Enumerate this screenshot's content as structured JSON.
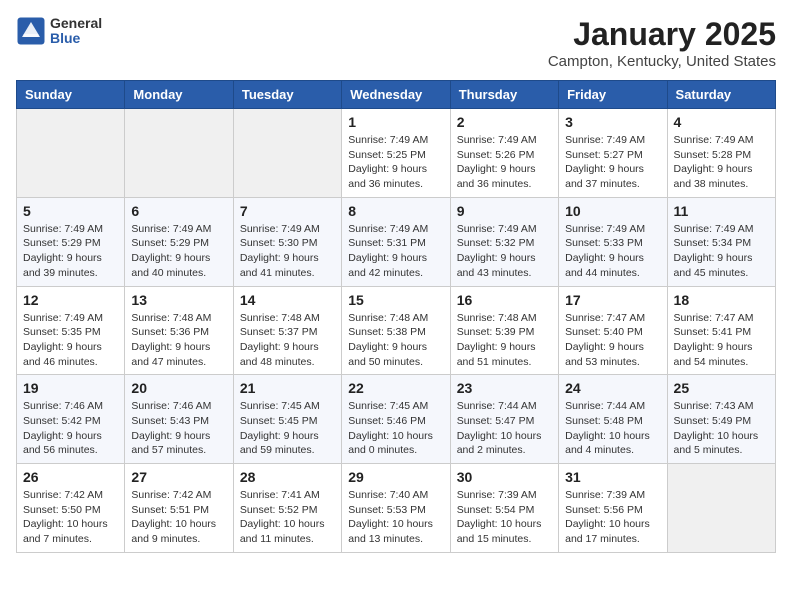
{
  "header": {
    "logo_general": "General",
    "logo_blue": "Blue",
    "month": "January 2025",
    "location": "Campton, Kentucky, United States"
  },
  "weekdays": [
    "Sunday",
    "Monday",
    "Tuesday",
    "Wednesday",
    "Thursday",
    "Friday",
    "Saturday"
  ],
  "weeks": [
    [
      {
        "day": "",
        "info": ""
      },
      {
        "day": "",
        "info": ""
      },
      {
        "day": "",
        "info": ""
      },
      {
        "day": "1",
        "info": "Sunrise: 7:49 AM\nSunset: 5:25 PM\nDaylight: 9 hours and 36 minutes."
      },
      {
        "day": "2",
        "info": "Sunrise: 7:49 AM\nSunset: 5:26 PM\nDaylight: 9 hours and 36 minutes."
      },
      {
        "day": "3",
        "info": "Sunrise: 7:49 AM\nSunset: 5:27 PM\nDaylight: 9 hours and 37 minutes."
      },
      {
        "day": "4",
        "info": "Sunrise: 7:49 AM\nSunset: 5:28 PM\nDaylight: 9 hours and 38 minutes."
      }
    ],
    [
      {
        "day": "5",
        "info": "Sunrise: 7:49 AM\nSunset: 5:29 PM\nDaylight: 9 hours and 39 minutes."
      },
      {
        "day": "6",
        "info": "Sunrise: 7:49 AM\nSunset: 5:29 PM\nDaylight: 9 hours and 40 minutes."
      },
      {
        "day": "7",
        "info": "Sunrise: 7:49 AM\nSunset: 5:30 PM\nDaylight: 9 hours and 41 minutes."
      },
      {
        "day": "8",
        "info": "Sunrise: 7:49 AM\nSunset: 5:31 PM\nDaylight: 9 hours and 42 minutes."
      },
      {
        "day": "9",
        "info": "Sunrise: 7:49 AM\nSunset: 5:32 PM\nDaylight: 9 hours and 43 minutes."
      },
      {
        "day": "10",
        "info": "Sunrise: 7:49 AM\nSunset: 5:33 PM\nDaylight: 9 hours and 44 minutes."
      },
      {
        "day": "11",
        "info": "Sunrise: 7:49 AM\nSunset: 5:34 PM\nDaylight: 9 hours and 45 minutes."
      }
    ],
    [
      {
        "day": "12",
        "info": "Sunrise: 7:49 AM\nSunset: 5:35 PM\nDaylight: 9 hours and 46 minutes."
      },
      {
        "day": "13",
        "info": "Sunrise: 7:48 AM\nSunset: 5:36 PM\nDaylight: 9 hours and 47 minutes."
      },
      {
        "day": "14",
        "info": "Sunrise: 7:48 AM\nSunset: 5:37 PM\nDaylight: 9 hours and 48 minutes."
      },
      {
        "day": "15",
        "info": "Sunrise: 7:48 AM\nSunset: 5:38 PM\nDaylight: 9 hours and 50 minutes."
      },
      {
        "day": "16",
        "info": "Sunrise: 7:48 AM\nSunset: 5:39 PM\nDaylight: 9 hours and 51 minutes."
      },
      {
        "day": "17",
        "info": "Sunrise: 7:47 AM\nSunset: 5:40 PM\nDaylight: 9 hours and 53 minutes."
      },
      {
        "day": "18",
        "info": "Sunrise: 7:47 AM\nSunset: 5:41 PM\nDaylight: 9 hours and 54 minutes."
      }
    ],
    [
      {
        "day": "19",
        "info": "Sunrise: 7:46 AM\nSunset: 5:42 PM\nDaylight: 9 hours and 56 minutes."
      },
      {
        "day": "20",
        "info": "Sunrise: 7:46 AM\nSunset: 5:43 PM\nDaylight: 9 hours and 57 minutes."
      },
      {
        "day": "21",
        "info": "Sunrise: 7:45 AM\nSunset: 5:45 PM\nDaylight: 9 hours and 59 minutes."
      },
      {
        "day": "22",
        "info": "Sunrise: 7:45 AM\nSunset: 5:46 PM\nDaylight: 10 hours and 0 minutes."
      },
      {
        "day": "23",
        "info": "Sunrise: 7:44 AM\nSunset: 5:47 PM\nDaylight: 10 hours and 2 minutes."
      },
      {
        "day": "24",
        "info": "Sunrise: 7:44 AM\nSunset: 5:48 PM\nDaylight: 10 hours and 4 minutes."
      },
      {
        "day": "25",
        "info": "Sunrise: 7:43 AM\nSunset: 5:49 PM\nDaylight: 10 hours and 5 minutes."
      }
    ],
    [
      {
        "day": "26",
        "info": "Sunrise: 7:42 AM\nSunset: 5:50 PM\nDaylight: 10 hours and 7 minutes."
      },
      {
        "day": "27",
        "info": "Sunrise: 7:42 AM\nSunset: 5:51 PM\nDaylight: 10 hours and 9 minutes."
      },
      {
        "day": "28",
        "info": "Sunrise: 7:41 AM\nSunset: 5:52 PM\nDaylight: 10 hours and 11 minutes."
      },
      {
        "day": "29",
        "info": "Sunrise: 7:40 AM\nSunset: 5:53 PM\nDaylight: 10 hours and 13 minutes."
      },
      {
        "day": "30",
        "info": "Sunrise: 7:39 AM\nSunset: 5:54 PM\nDaylight: 10 hours and 15 minutes."
      },
      {
        "day": "31",
        "info": "Sunrise: 7:39 AM\nSunset: 5:56 PM\nDaylight: 10 hours and 17 minutes."
      },
      {
        "day": "",
        "info": ""
      }
    ]
  ]
}
